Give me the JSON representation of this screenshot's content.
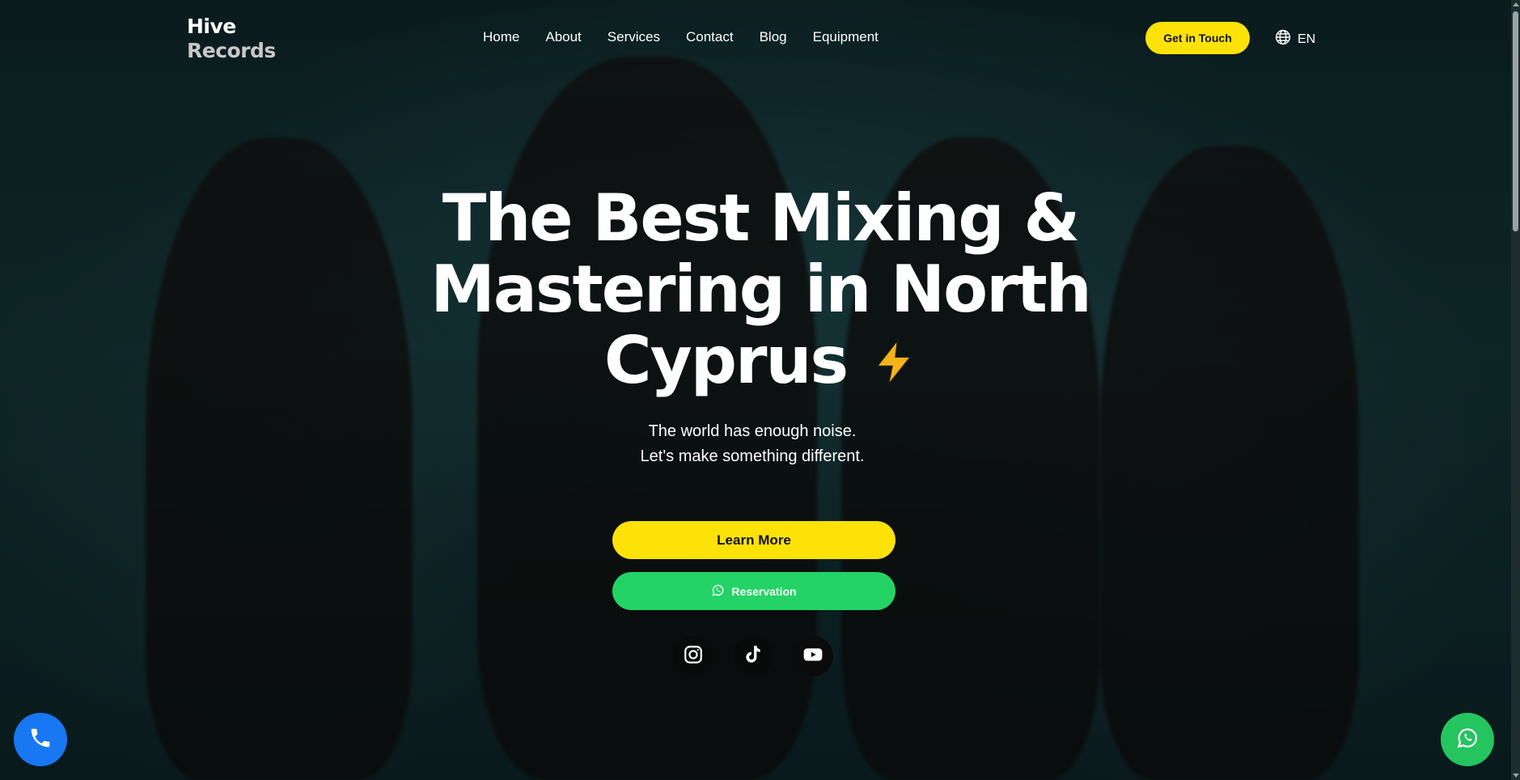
{
  "brand": {
    "line1": "Hive",
    "line2": "Records"
  },
  "nav": {
    "items": [
      {
        "label": "Home"
      },
      {
        "label": "About"
      },
      {
        "label": "Services"
      },
      {
        "label": "Contact"
      },
      {
        "label": "Blog"
      },
      {
        "label": "Equipment"
      }
    ]
  },
  "header": {
    "cta_label": "Get in Touch",
    "language": "EN",
    "language_icon": "globe-icon"
  },
  "hero": {
    "headline_line1": "The Best Mixing &",
    "headline_line2": "Mastering in North",
    "headline_line3": "Cyprus",
    "headline_icon": "lightning-bolt-icon",
    "subtitle_line1": "The world has enough noise.",
    "subtitle_line2": "Let's make something different.",
    "learn_more_label": "Learn More",
    "reservation_label": "Reservation",
    "reservation_icon": "whatsapp-icon"
  },
  "socials": [
    {
      "icon": "instagram-icon"
    },
    {
      "icon": "tiktok-icon"
    },
    {
      "icon": "youtube-icon"
    }
  ],
  "floating": {
    "phone_icon": "phone-icon",
    "whatsapp_icon": "whatsapp-icon"
  },
  "colors": {
    "accent_yellow": "#fde207",
    "whatsapp_green": "#24d366",
    "phone_blue": "#1877f2"
  }
}
